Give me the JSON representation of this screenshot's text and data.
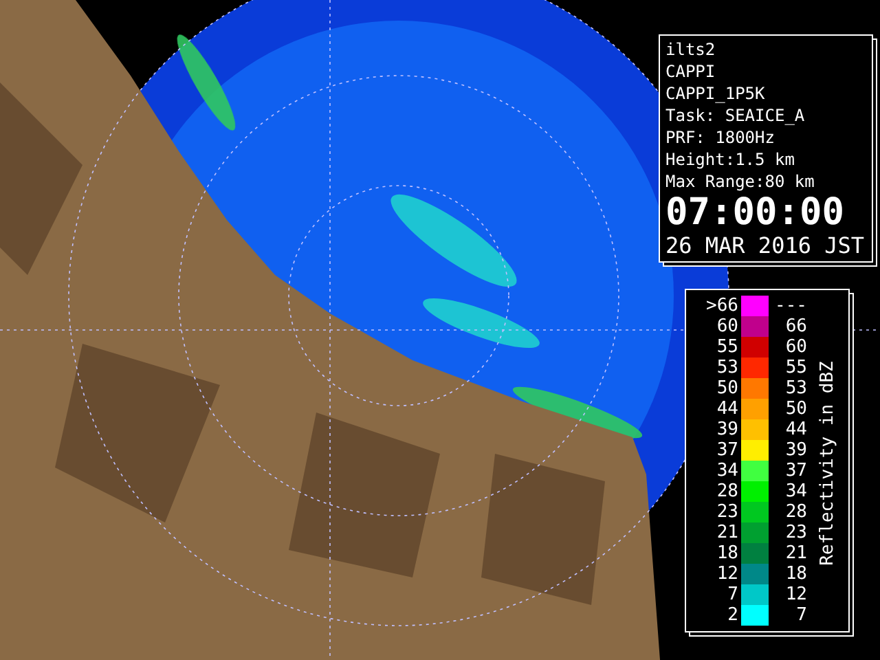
{
  "info_panel": {
    "lines": [
      "ilts2",
      "CAPPI",
      "CAPPI_1P5K",
      "Task: SEAICE_A",
      "PRF: 1800Hz",
      "Height:1.5 km",
      "Max Range:80 km"
    ],
    "time": "07:00:00",
    "date": "26 MAR 2016 JST"
  },
  "legend": {
    "title": "Reflectivity in dBZ",
    "rows": [
      {
        "low": ">66",
        "high": "---",
        "color": "#ff00ff"
      },
      {
        "low": "60",
        "high": "66",
        "color": "#c0008c"
      },
      {
        "low": "55",
        "high": "60",
        "color": "#d00000"
      },
      {
        "low": "53",
        "high": "55",
        "color": "#ff2800"
      },
      {
        "low": "50",
        "high": "53",
        "color": "#ff7800"
      },
      {
        "low": "44",
        "high": "50",
        "color": "#ffa000"
      },
      {
        "low": "39",
        "high": "44",
        "color": "#ffc000"
      },
      {
        "low": "37",
        "high": "39",
        "color": "#ffee00"
      },
      {
        "low": "34",
        "high": "37",
        "color": "#40ff40"
      },
      {
        "low": "28",
        "high": "34",
        "color": "#00f000"
      },
      {
        "low": "23",
        "high": "28",
        "color": "#00c820"
      },
      {
        "low": "21",
        "high": "23",
        "color": "#00a030"
      },
      {
        "low": "18",
        "high": "21",
        "color": "#008040"
      },
      {
        "low": "12",
        "high": "18",
        "color": "#008888"
      },
      {
        "low": "7",
        "high": "12",
        "color": "#00c8c8"
      },
      {
        "low": "2",
        "high": "7",
        "color": "#00ffff"
      }
    ]
  }
}
